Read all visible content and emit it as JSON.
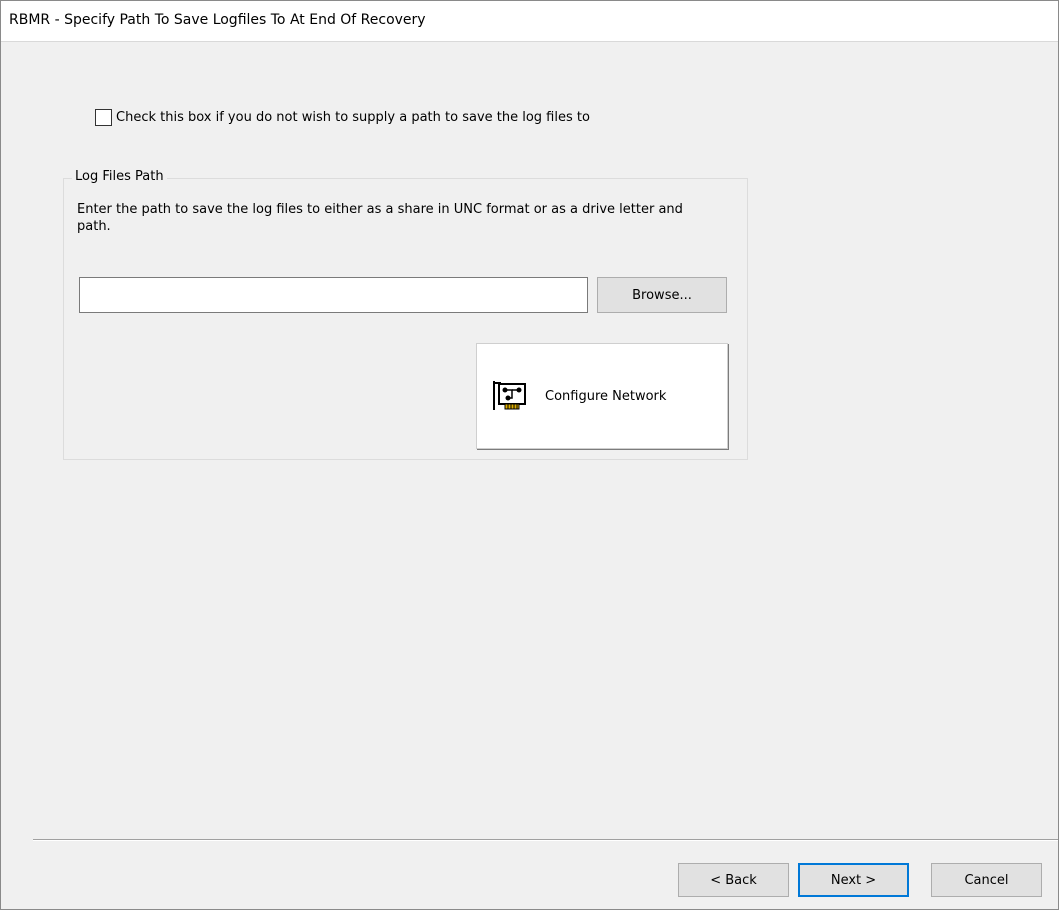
{
  "window": {
    "title": "RBMR - Specify Path To Save Logfiles To At End Of Recovery"
  },
  "options": {
    "no_path_checkbox_label": "Check this box if you do not wish to supply a path to save the log files to",
    "no_path_checked": false
  },
  "log_files_group": {
    "legend": "Log Files Path",
    "description": "Enter the path to save the log files to either as a share in UNC format or as a drive letter and path.",
    "path_value": "",
    "browse_label": "Browse...",
    "configure_network_label": "Configure Network",
    "configure_network_icon": "network-card-icon"
  },
  "footer": {
    "back_label": "< Back",
    "next_label": "Next >",
    "cancel_label": "Cancel",
    "default_button_color": "#0078d7"
  }
}
